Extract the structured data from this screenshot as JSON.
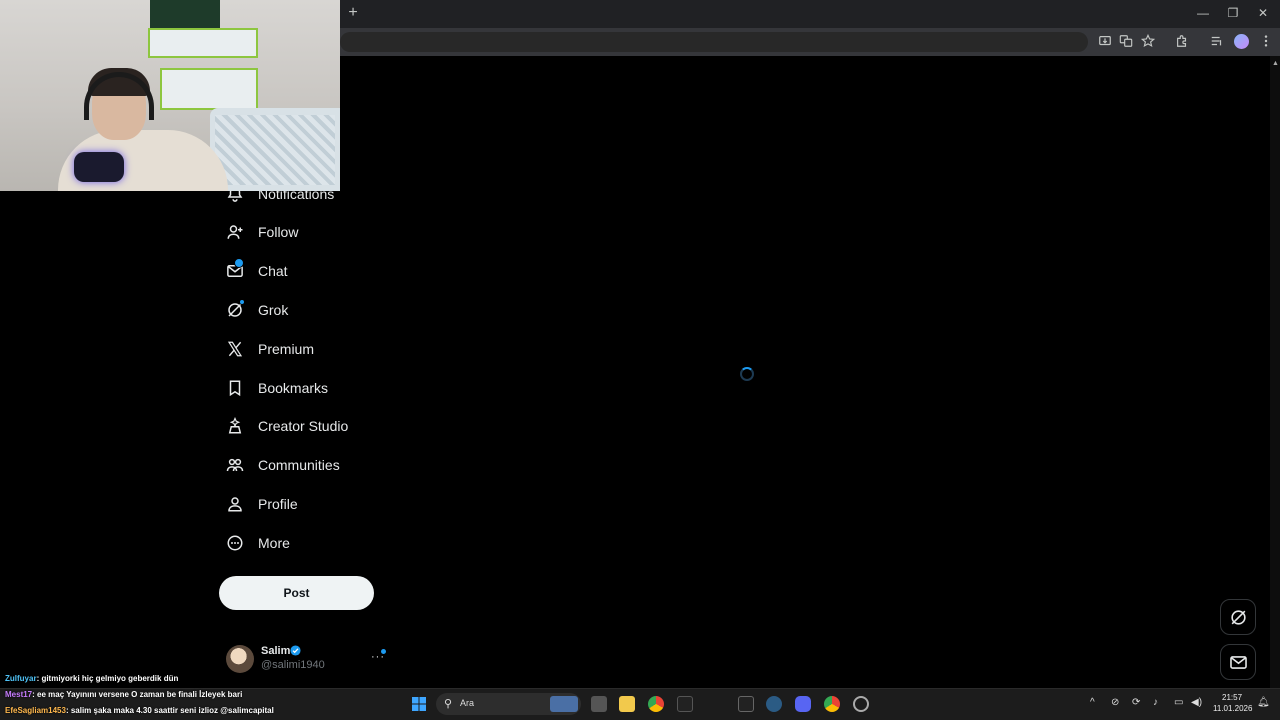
{
  "browser": {
    "new_tab": "+",
    "minimize": "—",
    "maximize": "❐",
    "close": "✕"
  },
  "sidebar": {
    "items": [
      {
        "label": "Notifications",
        "icon": "bell-icon"
      },
      {
        "label": "Follow",
        "icon": "person-add-icon"
      },
      {
        "label": "Chat",
        "icon": "envelope-icon"
      },
      {
        "label": "Grok",
        "icon": "grok-icon"
      },
      {
        "label": "Premium",
        "icon": "x-logo-icon"
      },
      {
        "label": "Bookmarks",
        "icon": "bookmark-icon"
      },
      {
        "label": "Creator Studio",
        "icon": "creator-studio-icon"
      },
      {
        "label": "Communities",
        "icon": "communities-icon"
      },
      {
        "label": "Profile",
        "icon": "person-icon"
      },
      {
        "label": "More",
        "icon": "more-circle-icon"
      }
    ],
    "post_label": "Post"
  },
  "account": {
    "name": "Salim",
    "handle": "@salimi1940",
    "more": "···"
  },
  "chat": [
    {
      "user": "Zulfuyar",
      "text": ": gitmiyorki hiç gelmiyo geberdik dün"
    },
    {
      "user": "Mest17",
      "text": ": ee maç Yayınını versene O zaman be finali İzleyek bari"
    },
    {
      "user": "EfeSagliam1453",
      "text": ": salim şaka maka 4.30 saattir seni izlioz @salimcapital"
    }
  ],
  "taskbar": {
    "search_placeholder": "Ara",
    "time": "21:57",
    "date": "11.01.2026"
  },
  "colors": {
    "accent": "#1d9bf0",
    "background": "#000000",
    "text": "#e7e9ea",
    "muted": "#71767b"
  }
}
